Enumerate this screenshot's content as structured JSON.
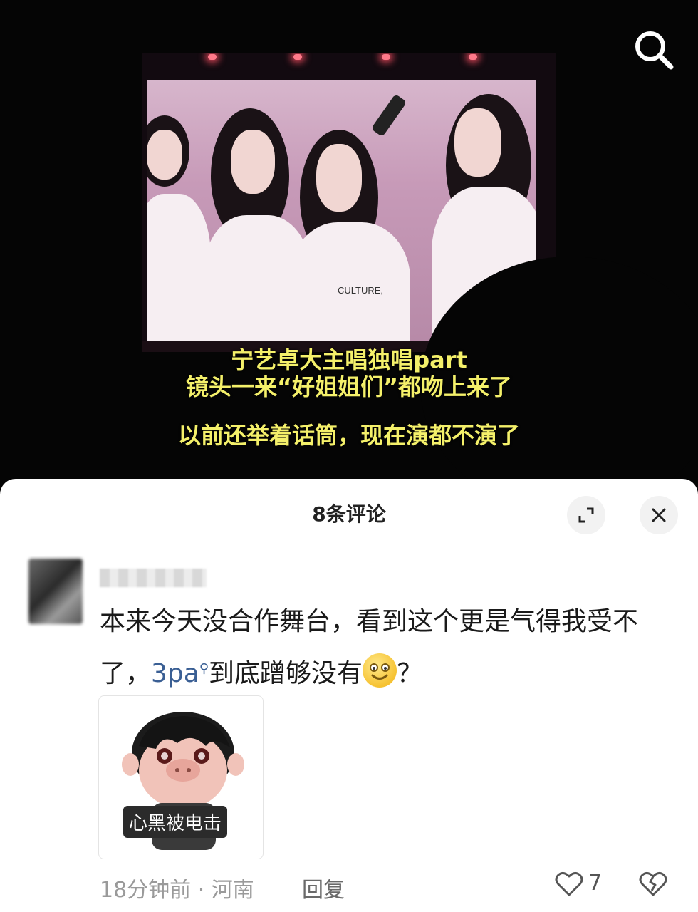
{
  "video": {
    "caption_line1": "宁艺卓大主唱独唱part",
    "caption_line2": "镜头一来“好姐姐们”都吻上来了",
    "caption_line3": "以前还举着话筒，现在演都不演了",
    "shirt_text": "CULTURE,",
    "search_icon": "search-icon"
  },
  "sheet": {
    "title": "8条评论",
    "expand_icon": "expand-icon",
    "close_icon": "close-icon"
  },
  "comment": {
    "text_before_link": "本来今天没合作舞台，看到这个更是气得我受不了，",
    "link_text": "3pa",
    "text_after_link": "到底蹭够没有",
    "text_end": "？",
    "sticker_label": "心黑被电击",
    "meta": "18分钟前 · 河南",
    "reply_label": "回复",
    "like_count": "7"
  },
  "colors": {
    "caption": "#f4f06a",
    "link": "#3a5f94",
    "sheet_bg": "#ffffff"
  }
}
